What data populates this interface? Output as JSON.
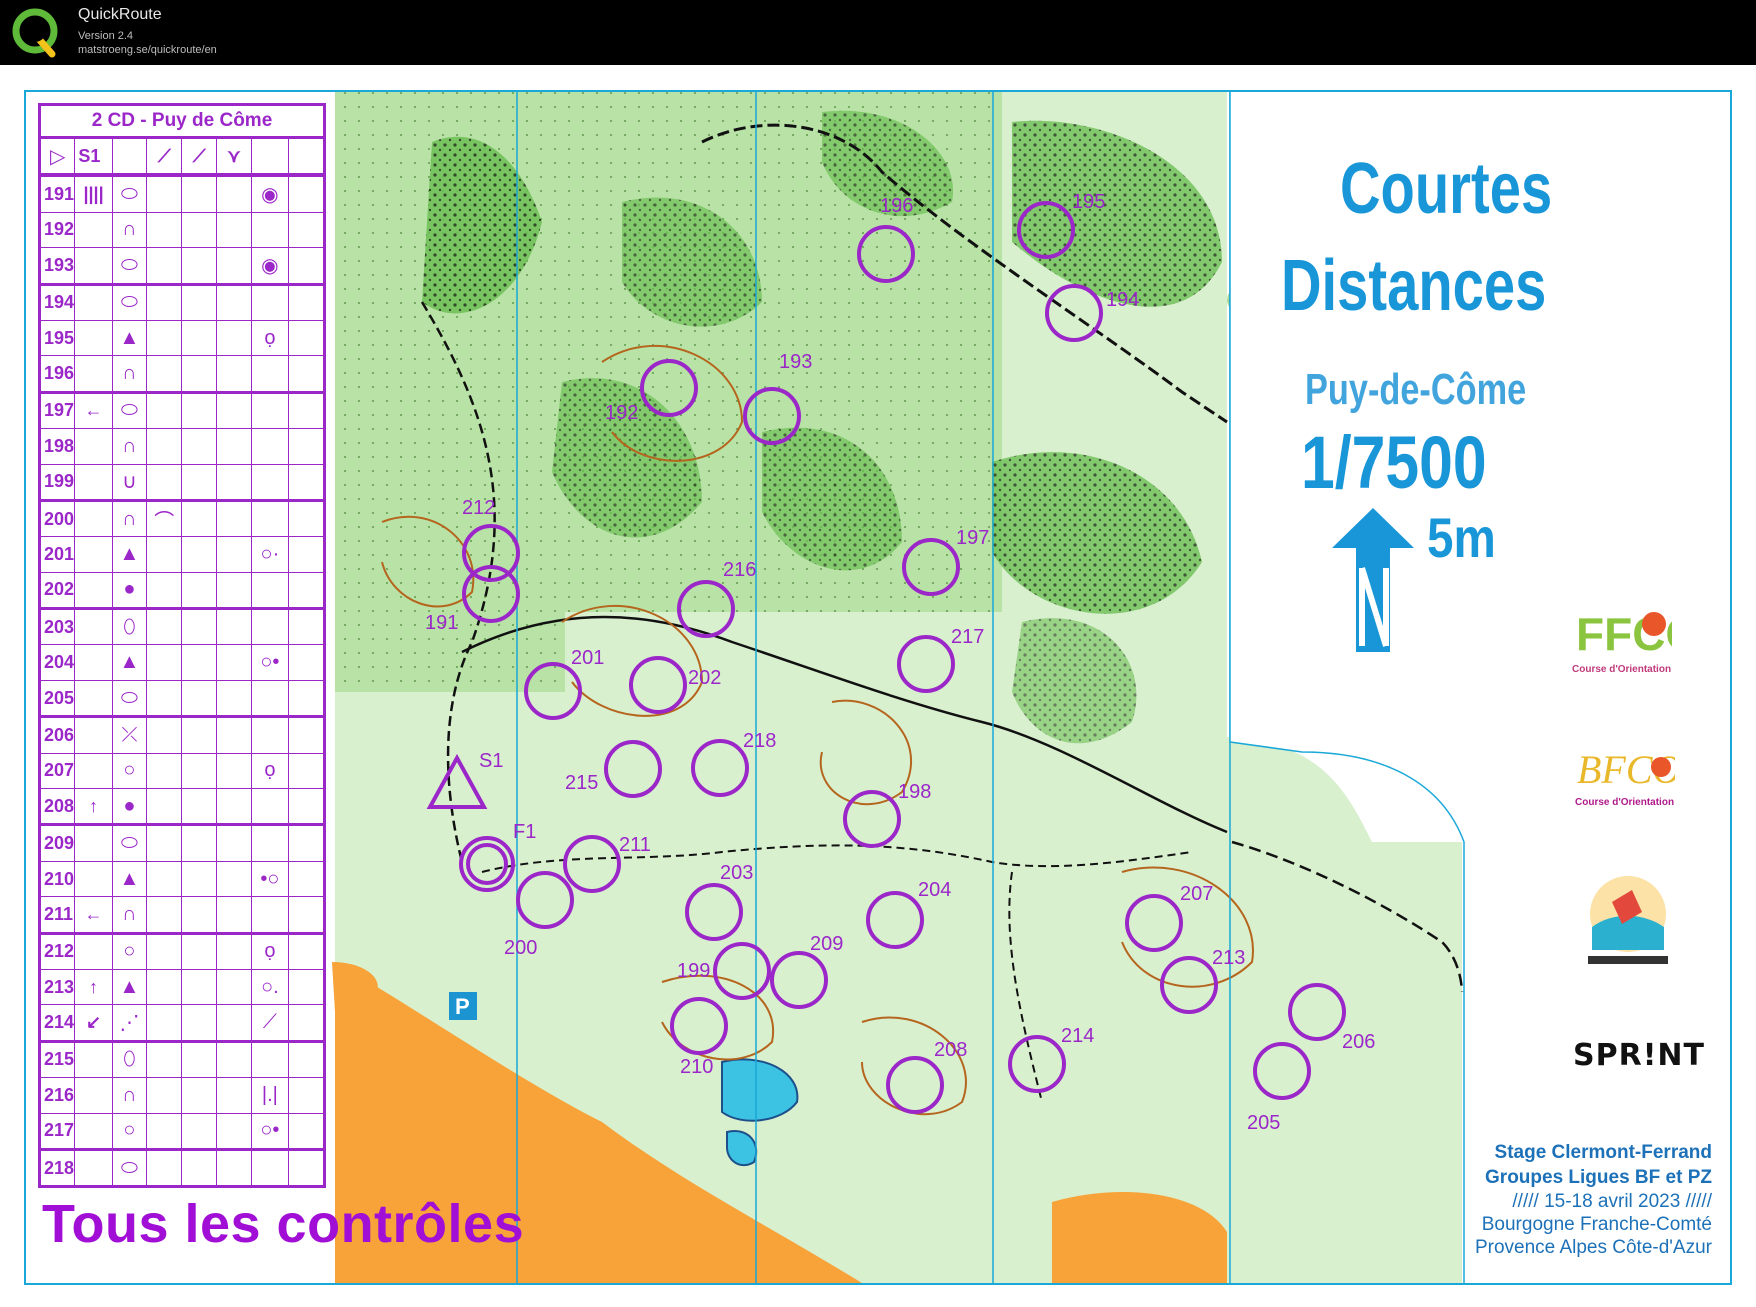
{
  "window": {
    "app_name": "QuickRoute",
    "version": "Version 2.4",
    "url": "matstroeng.se/quickroute/en"
  },
  "description_sheet": {
    "title": "2 CD - Puy de Côme",
    "start_code": "S1",
    "rows": [
      {
        "code": "191",
        "dir": "||||",
        "feat": "pit-oval",
        "detail": "",
        "loc": "circle-dot"
      },
      {
        "code": "192",
        "dir": "",
        "feat": "knoll",
        "detail": "",
        "loc": ""
      },
      {
        "code": "193",
        "dir": "",
        "feat": "pit-oval",
        "detail": "",
        "loc": "circle-dot"
      },
      {
        "code": "194",
        "dir": "",
        "feat": "pit-oval",
        "detail": "",
        "loc": ""
      },
      {
        "code": "195",
        "dir": "",
        "feat": "triangle",
        "detail": "",
        "loc": "circle-top"
      },
      {
        "code": "196",
        "dir": "",
        "feat": "knoll",
        "detail": "",
        "loc": ""
      },
      {
        "code": "197",
        "dir": "←",
        "feat": "pit-oval",
        "detail": "",
        "loc": ""
      },
      {
        "code": "198",
        "dir": "",
        "feat": "knoll",
        "detail": "",
        "loc": ""
      },
      {
        "code": "199",
        "dir": "",
        "feat": "depression",
        "detail": "",
        "loc": ""
      },
      {
        "code": "200",
        "dir": "",
        "feat": "knoll",
        "detail": "arc",
        "loc": ""
      },
      {
        "code": "201",
        "dir": "",
        "feat": "triangle",
        "detail": "",
        "loc": "circle-ne"
      },
      {
        "code": "202",
        "dir": "",
        "feat": "dot",
        "detail": "",
        "loc": ""
      },
      {
        "code": "203",
        "dir": "",
        "feat": "oval",
        "detail": "",
        "loc": ""
      },
      {
        "code": "204",
        "dir": "",
        "feat": "triangle",
        "detail": "",
        "loc": "circle-e"
      },
      {
        "code": "205",
        "dir": "",
        "feat": "pit-oval",
        "detail": "",
        "loc": ""
      },
      {
        "code": "206",
        "dir": "",
        "feat": "tree",
        "detail": "",
        "loc": ""
      },
      {
        "code": "207",
        "dir": "",
        "feat": "circle",
        "detail": "",
        "loc": "circle-top"
      },
      {
        "code": "208",
        "dir": "↑",
        "feat": "dot",
        "detail": "",
        "loc": ""
      },
      {
        "code": "209",
        "dir": "",
        "feat": "pit-oval",
        "detail": "",
        "loc": ""
      },
      {
        "code": "210",
        "dir": "",
        "feat": "triangle",
        "detail": "",
        "loc": "circle-w"
      },
      {
        "code": "211",
        "dir": "←",
        "feat": "knoll",
        "detail": "",
        "loc": ""
      },
      {
        "code": "212",
        "dir": "",
        "feat": "circle",
        "detail": "",
        "loc": "circle-top"
      },
      {
        "code": "213",
        "dir": "↑",
        "feat": "triangle",
        "detail": "",
        "loc": "circle-se"
      },
      {
        "code": "214",
        "dir": "↙",
        "feat": "dotted-line",
        "detail": "",
        "loc": "junction"
      },
      {
        "code": "215",
        "dir": "",
        "feat": "oval",
        "detail": "",
        "loc": ""
      },
      {
        "code": "216",
        "dir": "",
        "feat": "knoll",
        "detail": "",
        "loc": "bar-dot"
      },
      {
        "code": "217",
        "dir": "",
        "feat": "circle",
        "detail": "",
        "loc": "circle-e"
      },
      {
        "code": "218",
        "dir": "",
        "feat": "pit-oval",
        "detail": "",
        "loc": ""
      }
    ]
  },
  "caption": "Tous les contrôles",
  "map_title": {
    "line1": "Courtes",
    "line2": "Distances",
    "place": "Puy-de-Côme",
    "scale": "1/7500",
    "contour": "5m"
  },
  "logos": {
    "ffco": "FFCO",
    "ffco_sub": "Course d'Orientation",
    "bfco": "BFCO",
    "bfco_sub": "Course d'Orientation",
    "sprint": "SPR!NT"
  },
  "event": {
    "title1": "Stage Clermont-Ferrand",
    "title2": "Groupes Ligues BF et PZ",
    "dates": "///// 15-18 avril 2023  /////",
    "region1": "Bourgogne Franche-Comté",
    "region2": "Provence Alpes Côte-d'Azur"
  },
  "controls": [
    "191",
    "192",
    "193",
    "194",
    "195",
    "196",
    "197",
    "198",
    "199",
    "200",
    "201",
    "202",
    "203",
    "204",
    "205",
    "206",
    "207",
    "208",
    "209",
    "210",
    "211",
    "212",
    "213",
    "214",
    "215",
    "216",
    "217",
    "218"
  ],
  "start_label": "S1",
  "finish_label": "F1",
  "parking_label": "P",
  "colors": {
    "course": "#9b27c9",
    "map_frame": "#19a8d8",
    "title_blue": "#1996d8",
    "forest_green": "#8fd17a",
    "open_yellow": "#f7a33a"
  }
}
